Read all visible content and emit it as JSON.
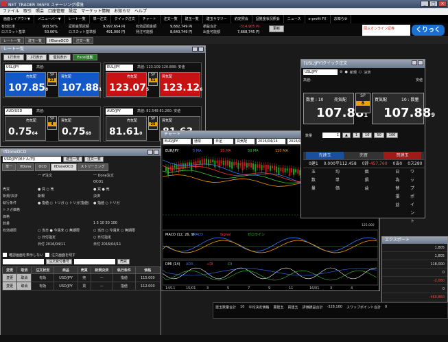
{
  "app": {
    "title": "NET_TRADER 365FX ステージング環境"
  },
  "menu": [
    "ファイル",
    "取引",
    "照会",
    "口座管理",
    "設定",
    "マーケット情報",
    "お知らせ",
    "ヘルプ"
  ],
  "toolbar": [
    "画面レイアウト▼",
    "メニューバー▼",
    "レート一覧",
    "単一注文",
    "クイック注文",
    "チャート",
    "注文一覧",
    "建玉一覧",
    "建玉サマリー",
    "約定照会",
    "証拠金状況照会",
    "ニュース",
    "e-profit FX",
    "お知らせ"
  ],
  "account": [
    {
      "l1": "有効比率",
      "v1": "903.50%",
      "l2": "ロスカット基準",
      "v2": "50.00%"
    },
    {
      "l1": "証拠金預託額",
      "v1": "9,997,654 円",
      "l2": "ロスカット基準額",
      "v2": "491,000 円"
    },
    {
      "l1": "有効証拠金額",
      "v1": "9,682,749 円",
      "l2": "発注可能額",
      "v2": "8,640,749 円"
    },
    {
      "l1": "損益合計",
      "v1": "-314,905 円",
      "l2": "出金可能額",
      "v2": "7,668,745 円"
    }
  ],
  "update_button": "更新",
  "brand": "岡三オンライン証券",
  "brand2": "くりっく365",
  "tabs": [
    {
      "label": "レート一覧",
      "active": false
    },
    {
      "label": "建玉一覧",
      "active": false
    },
    {
      "label": "IfDoneOCO",
      "active": true
    },
    {
      "label": "注文一覧",
      "active": false
    }
  ],
  "rate": {
    "title": "レート一覧",
    "buttons": [
      "1行表示",
      "2行表示",
      "個別表示",
      "Excel連動"
    ],
    "pairs": [
      {
        "sym": "USL/JPY",
        "hl": "高値:",
        "sellLabel": "売気配",
        "buyLabel": "買気配",
        "sell": "107.85",
        "sellSub": "8",
        "sp": "23",
        "buy": "107.88",
        "buySub": "1",
        "color": "blue"
      },
      {
        "sym": "EUL/JPY",
        "hl": "高値: 123.109  120.888: 安値",
        "sellLabel": "売気配",
        "buyLabel": "買気配",
        "sell": "123.07",
        "sellSub": "5",
        "sp": "51",
        "buy": "123.12",
        "buySub": "6",
        "color": "red"
      },
      {
        "sym": "AUD/USD",
        "hl": "高値:",
        "sellLabel": "売気配",
        "buyLabel": "買気配",
        "sell": "0.75",
        "sellSub": "64",
        "sp": "4",
        "buy": "0.75",
        "buySub": "68",
        "color": "none"
      },
      {
        "sym": "AUD/JPY",
        "hl": "高値: 81.548  81.260: 安値",
        "sellLabel": "売気配",
        "buyLabel": "買気配",
        "sell": "81.61",
        "sellSub": "0",
        "sp": "25",
        "buy": "81.63",
        "buySub": "5",
        "color": "none"
      }
    ]
  },
  "ifd": {
    "title": "IfDoneOCO",
    "symbol": "USD/JPY(米ドル/円)",
    "pos_btn": "建玉一覧",
    "ord_btn": "注文一覧",
    "tabs": [
      {
        "l": "単一",
        "on": false
      },
      {
        "l": "IfDone",
        "on": false
      },
      {
        "l": "OCO",
        "on": false
      },
      {
        "l": "IfDoneOCO",
        "on": true
      },
      {
        "l": "ストリーミング",
        "on": false
      }
    ],
    "first": "一 IF注文",
    "done": "一 Done注文",
    "oco1": "OCO1",
    "rows": [
      {
        "label": "売買",
        "a": "● 買  ○ 売",
        "b": "● 買  ● 売"
      },
      {
        "label": "新規/決済",
        "a": "新規",
        "b": "決済"
      },
      {
        "label": "執行条件",
        "a": "● 指値 ○ トリガ ○ トリガ(指値)",
        "b": "● 指値 ○ トリガ"
      },
      {
        "label": "トリガ価格",
        "a": "",
        "b": ""
      },
      {
        "label": "価格",
        "a": "",
        "b": ""
      },
      {
        "label": "数量",
        "a": "",
        "b": "1  5  10  50  100"
      },
      {
        "label": "有効期限",
        "a": "○ 当日  ● 今週末  ○ 無期限",
        "b": "○ 当日 ○ 今週末 ○ 無期限"
      },
      {
        "label": "",
        "a": "○ 日付指定",
        "b": "○ 日付指定"
      },
      {
        "label": "",
        "a": "日付 2016/04/11",
        "b": "日付 2016/04/11"
      }
    ],
    "check1": "確認画面を表示しない",
    "check2": "注文画面を残す",
    "order_no": "注文受付番号",
    "sell_btn": "売買",
    "headers": [
      "変更",
      "取消",
      "注文状況",
      "商品",
      "売買",
      "新規決済",
      "執行条件",
      "価格"
    ],
    "orders": [
      {
        "edit": "変更",
        "cancel": "取消",
        "status": "有効",
        "sub": "単一",
        "sym": "USD/JPY",
        "side": "売",
        "nc": "—",
        "cond": "指値",
        "price": "115.000"
      },
      {
        "edit": "変更",
        "cancel": "取消",
        "status": "有効",
        "sub": "単一",
        "sym": "USD/JPY",
        "side": "買",
        "nc": "—",
        "cond": "指値",
        "price": "112.000"
      }
    ]
  },
  "chart": {
    "title": "チャート",
    "sym": "EUR/JPY",
    "kind": "通常",
    "freq": "日足",
    "bar": "買気配",
    "date1": "2016/04/14",
    "date2": "2016/04/11",
    "legend": [
      "EUR/JPY",
      "5 MA",
      "15 MA",
      "50 MA",
      "120 MA"
    ],
    "pricelabel": "127.000",
    "macd_legend": [
      "MACD (12, 26, 9)",
      "MACD",
      "Signal",
      "ゼロライン"
    ],
    "dmi_legend": [
      "DMI (14)",
      "ADX",
      "+DI",
      "-DI"
    ],
    "x_labels": [
      "14/11",
      "15/01",
      "3",
      "5",
      "7",
      "9",
      "11",
      "16/01",
      "3",
      "4"
    ],
    "y_labels": [
      "140.000",
      "135.000",
      "130.000",
      "127.000",
      "125.000"
    ]
  },
  "quick": {
    "title": "[USL/JPY]クイック注文",
    "sym": "USL/JPY",
    "new": "新規",
    "settle": "決済",
    "hl": "高値:",
    "low": "安値",
    "sell_label": "数量 : 10",
    "sell_title": "売気配",
    "sell_price": "107.88",
    "sell_sub": "1",
    "buy_label": "買気配",
    "buy_qty": "10 : 数量",
    "buy_price": "107.88",
    "buy_sub": "9",
    "sp": "8",
    "qty_label": "数量",
    "qty": "1",
    "qty_steps": [
      "1",
      "10",
      "50",
      "100"
    ],
    "t_h1": "売建玉",
    "t_h2": "売買",
    "t_h3": "買建玉",
    "rows": [
      {
        "l": "0",
        "m": "建玉数量",
        "r": "1"
      },
      {
        "l": "0.000",
        "m": "平均単価",
        "r": "112.458"
      },
      {
        "l": "0",
        "m": "評価損益",
        "r": "-457,760"
      },
      {
        "l": "0",
        "m": "当日為替損益",
        "r": "0"
      },
      {
        "l": "0",
        "m": "スワップポイント",
        "r": "280"
      }
    ]
  },
  "rpanel": {
    "title": "エクスポート",
    "values": [
      "1,805",
      "1,805",
      "118,000",
      "0",
      "-2,080",
      "0",
      "-460,860"
    ]
  },
  "bottom": {
    "items": [
      "建玉数量合計",
      "10",
      "平均決定価格",
      "賣建玉",
      "買建玉",
      "評価損益合計",
      "-328,160",
      "スワップポイント合計",
      "0"
    ]
  }
}
